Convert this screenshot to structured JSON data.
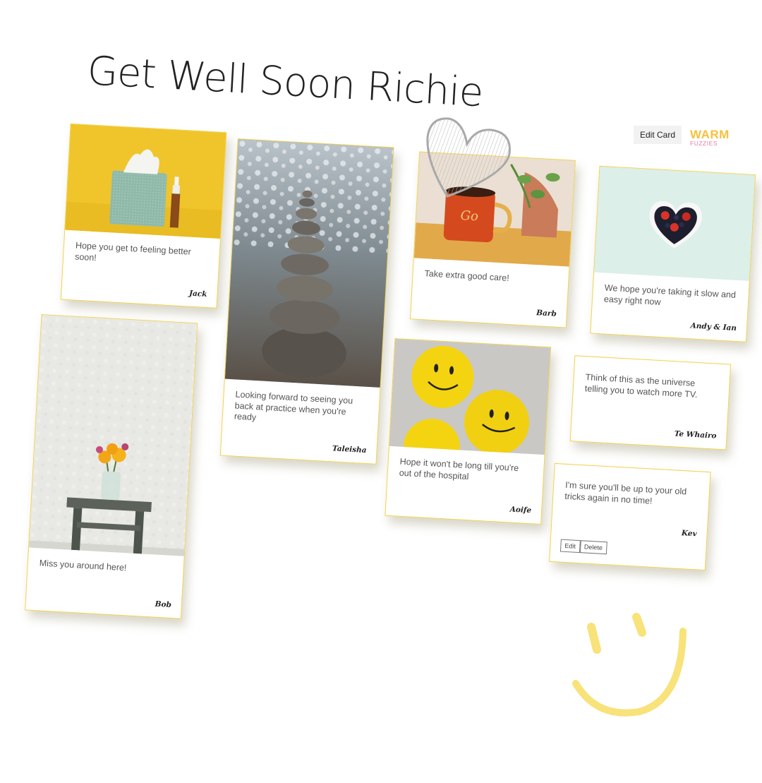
{
  "title": "Get Well Soon Richie",
  "toolbar": {
    "edit_card_label": "Edit Card"
  },
  "logo": {
    "line1": "WARM",
    "line2": "FUZZIES"
  },
  "cards": [
    {
      "message": "Hope you get to feeling better soon!",
      "signature": "Jack",
      "photo": "tissue-box-photo"
    },
    {
      "message": "Miss you around here!",
      "signature": "Bob",
      "photo": "flowers-on-stool-photo"
    },
    {
      "message": "Looking forward to seeing you back at practice when you're ready",
      "signature": "Taleisha",
      "photo": "stacked-stones-photo"
    },
    {
      "message": "Take extra good care!",
      "signature": "Barb",
      "photo": "coffee-mug-photo"
    },
    {
      "message": "Hope it won't be long till you're out of the hospital",
      "signature": "Aoife",
      "photo": "smiley-balloons-photo"
    },
    {
      "message": "We hope you're taking it slow and easy right now",
      "signature": "Andy & Ian",
      "photo": "heart-berries-photo"
    },
    {
      "message": "Think of this as the universe telling you to watch more TV.",
      "signature": "Te Whairo"
    },
    {
      "message": "I'm sure you'll be up to your old tricks again in no time!",
      "signature": "Kev",
      "actions": [
        "Edit",
        "Delete"
      ]
    }
  ],
  "colors": {
    "accent_yellow": "#f2d24b",
    "logo_yellow": "#f6c13d",
    "logo_pink": "#e879a8",
    "smiley": "#f8e27a"
  }
}
